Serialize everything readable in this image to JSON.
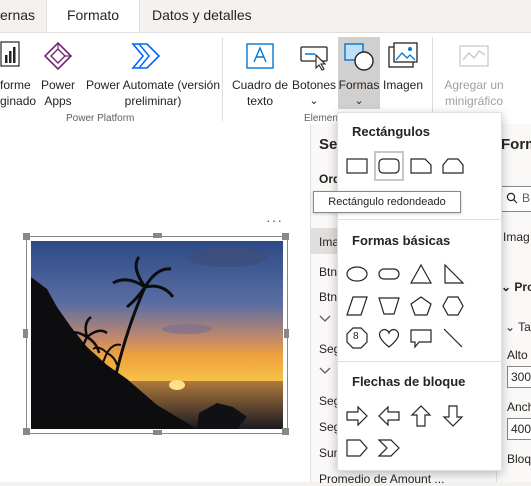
{
  "tabs": [
    "ernas",
    "Formato",
    "Datos y detalles"
  ],
  "ribbon": {
    "report_line1": "forme",
    "report_line2": "ginado",
    "powerapps_line1": "Power",
    "powerapps_line2": "Apps",
    "automate_line1": "Power Automate (versión",
    "automate_line2": "preliminar)",
    "group_power_platform": "Power Platform",
    "textbox_line1": "Cuadro de",
    "textbox_line2": "texto",
    "buttons_label": "Botones",
    "shapes_label": "Formas",
    "image_label": "Imagen",
    "group_elements": "Elemen",
    "smartnarr_line1": "Agregar un",
    "smartnarr_line2": "minigráfico",
    "chevron": "⌄"
  },
  "canvas": {
    "more": "···"
  },
  "pane": {
    "title": "Sel",
    "order": "Ord",
    "items": [
      "Imag",
      "Btn",
      "Btn",
      "Seg",
      "Seg",
      "Seg",
      "Sum",
      "Promedio de Amount ..."
    ]
  },
  "pane2": {
    "title": "Form",
    "search": "B",
    "image": "Imag",
    "prop": "Pro",
    "size": "Ta",
    "height_label": "Alto",
    "height_value": "300",
    "width_label": "Anch",
    "width_value": "400",
    "lock_label": "Bloq"
  },
  "dropdown": {
    "rect_header": "Rectángulos",
    "basic_header": "Formas básicas",
    "arrows_header": "Flechas de bloque",
    "octagon_number": "8"
  },
  "tooltip": "Rectángulo redondeado",
  "colors": {
    "accent": "#0078d4",
    "panel": "#faf9f8",
    "border": "#e1dfdd"
  }
}
